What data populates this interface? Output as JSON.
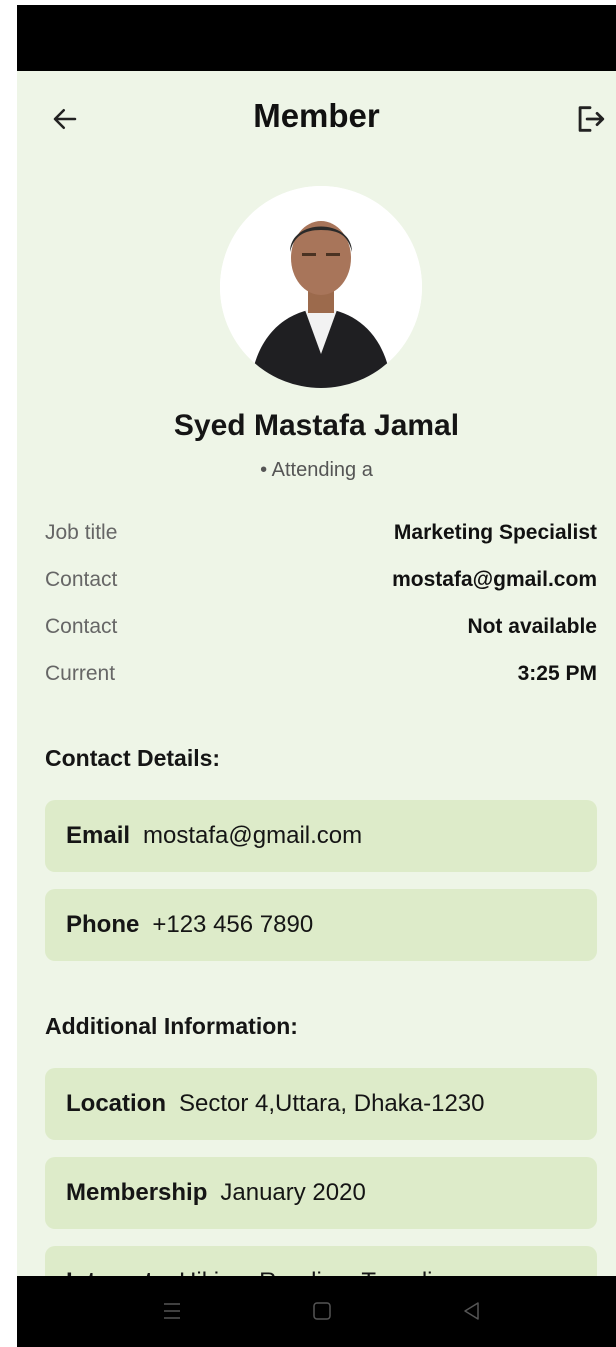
{
  "header": {
    "title": "Member",
    "back_icon": "arrow-left-icon",
    "logout_icon": "logout-icon"
  },
  "profile": {
    "name": "Syed Mastafa Jamal",
    "status": "• Attending a"
  },
  "info_rows": [
    {
      "label": "Job title",
      "value": "Marketing Specialist"
    },
    {
      "label": "Contact",
      "value": "mostafa@gmail.com"
    },
    {
      "label": "Contact",
      "value": "Not available"
    },
    {
      "label": "Current",
      "value": "3:25 PM"
    }
  ],
  "contact_details": {
    "title": "Contact Details:",
    "items": [
      {
        "key": "Email",
        "value": "mostafa@gmail.com"
      },
      {
        "key": "Phone",
        "value": "+123 456 7890"
      }
    ]
  },
  "additional_info": {
    "title": "Additional Information:",
    "items": [
      {
        "key": "Location",
        "value": "Sector 4,Uttara, Dhaka-1230"
      },
      {
        "key": "Membership",
        "value": "January 2020"
      },
      {
        "key": "Interests",
        "value": "Hiking, Reading, Traveling"
      }
    ]
  },
  "nav": {
    "menu_icon": "menu-icon",
    "home_icon": "home-square-icon",
    "back_icon": "back-triangle-icon"
  },
  "colors": {
    "background": "#eef5e7",
    "card": "#ddebc9",
    "system_bar": "#000000"
  }
}
